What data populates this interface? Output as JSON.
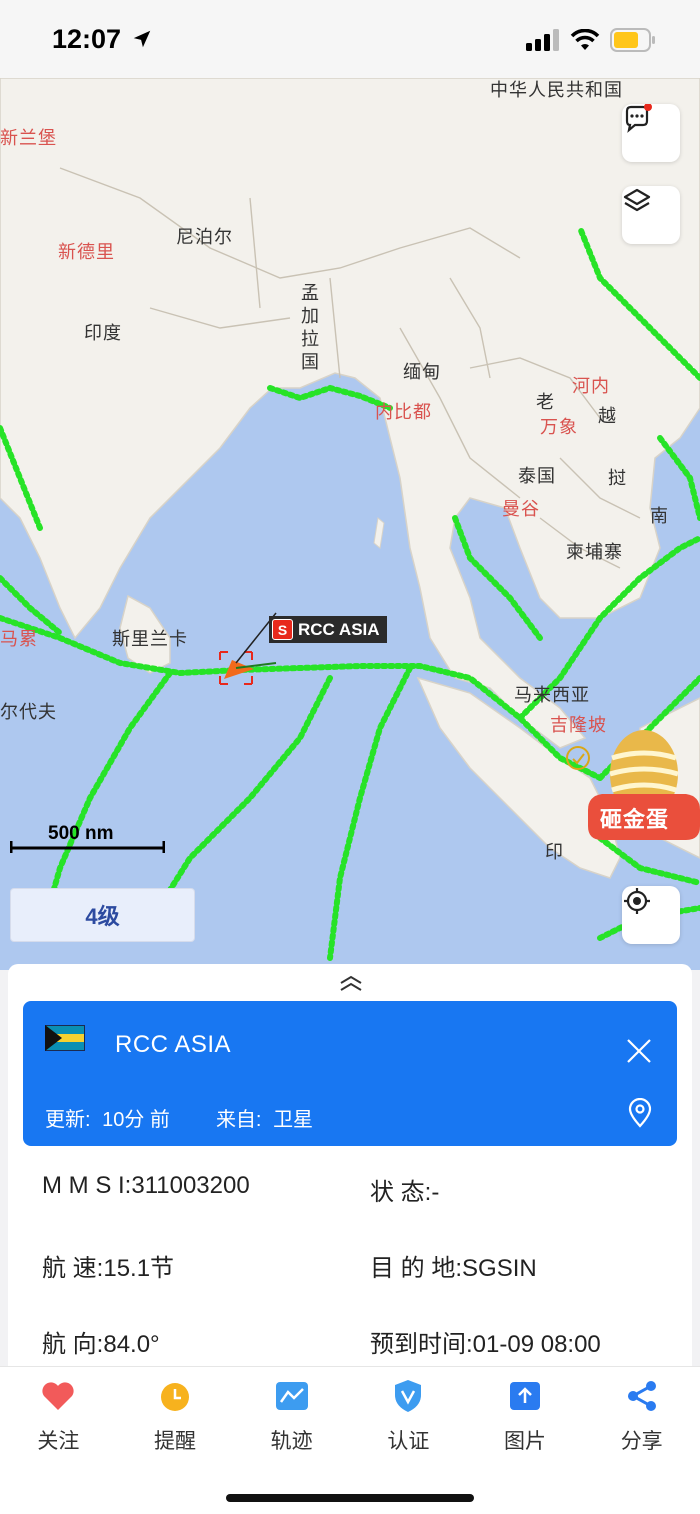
{
  "status_bar": {
    "time": "12:07",
    "battery_color": "#ffc61a"
  },
  "map": {
    "labels": {
      "china": "中华人民共和国",
      "new_zealand": "新兰堡",
      "nepal": "尼泊尔",
      "new_delhi": "新德里",
      "india": "印度",
      "bangladesh": "孟加拉国",
      "myanmar": "缅甸",
      "naypyidaw": "内比都",
      "hanoi": "河内",
      "laos": "老",
      "vientiane": "万象",
      "vietnam_1": "越",
      "thailand": "泰国",
      "vietnam_2": "挝",
      "bangkok": "曼谷",
      "south": "南",
      "cambodia": "柬埔寨",
      "sri_lanka": "斯里兰卡",
      "maldives_left": "马累",
      "maldives": "尔代夫",
      "malaysia": "马来西亚",
      "kuala_lumpur": "吉隆坡",
      "indonesia": "印"
    },
    "scale_label": "500 nm",
    "level_label": "4级",
    "ship_tag": {
      "badge": "S",
      "name": "RCC ASIA"
    },
    "egg_label": "砸金蛋"
  },
  "panel": {
    "ship_name": "RCC ASIA",
    "update_label": "更新:",
    "update_value": "10分 前",
    "source_label": "来自:",
    "source_value": "卫星",
    "rows": [
      {
        "label": "M  M  S  I",
        "value": "311003200"
      },
      {
        "label": "状        态",
        "value": "-"
      },
      {
        "label": "航        速",
        "value": "15.1节"
      },
      {
        "label": "目  的  地",
        "value": "SGSIN"
      },
      {
        "label": "航        向",
        "value": "84.0°"
      },
      {
        "label": "预到时间",
        "value": "01-09 08:00"
      }
    ]
  },
  "tabs": [
    {
      "label": "关注",
      "icon": "heart-icon",
      "color": "#f25a5a"
    },
    {
      "label": "提醒",
      "icon": "alarm-clock-icon",
      "color": "#f7b21e"
    },
    {
      "label": "轨迹",
      "icon": "track-icon",
      "color": "#3d9cf0"
    },
    {
      "label": "认证",
      "icon": "shield-icon",
      "color": "#3d9cf0"
    },
    {
      "label": "图片",
      "icon": "image-upload-icon",
      "color": "#2a7bf0"
    },
    {
      "label": "分享",
      "icon": "share-icon",
      "color": "#2a7bf0"
    }
  ]
}
